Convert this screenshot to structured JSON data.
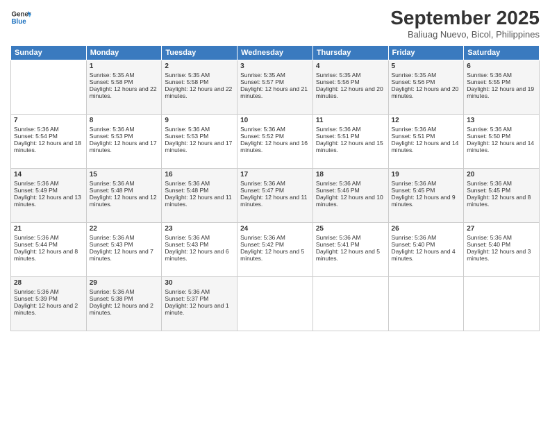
{
  "header": {
    "logo_line1": "General",
    "logo_line2": "Blue",
    "month_title": "September 2025",
    "subtitle": "Baliuag Nuevo, Bicol, Philippines"
  },
  "days_of_week": [
    "Sunday",
    "Monday",
    "Tuesday",
    "Wednesday",
    "Thursday",
    "Friday",
    "Saturday"
  ],
  "weeks": [
    [
      {
        "day": "",
        "empty": true
      },
      {
        "day": "1",
        "sunrise": "Sunrise: 5:35 AM",
        "sunset": "Sunset: 5:58 PM",
        "daylight": "Daylight: 12 hours and 22 minutes."
      },
      {
        "day": "2",
        "sunrise": "Sunrise: 5:35 AM",
        "sunset": "Sunset: 5:58 PM",
        "daylight": "Daylight: 12 hours and 22 minutes."
      },
      {
        "day": "3",
        "sunrise": "Sunrise: 5:35 AM",
        "sunset": "Sunset: 5:57 PM",
        "daylight": "Daylight: 12 hours and 21 minutes."
      },
      {
        "day": "4",
        "sunrise": "Sunrise: 5:35 AM",
        "sunset": "Sunset: 5:56 PM",
        "daylight": "Daylight: 12 hours and 20 minutes."
      },
      {
        "day": "5",
        "sunrise": "Sunrise: 5:35 AM",
        "sunset": "Sunset: 5:56 PM",
        "daylight": "Daylight: 12 hours and 20 minutes."
      },
      {
        "day": "6",
        "sunrise": "Sunrise: 5:36 AM",
        "sunset": "Sunset: 5:55 PM",
        "daylight": "Daylight: 12 hours and 19 minutes."
      }
    ],
    [
      {
        "day": "7",
        "sunrise": "Sunrise: 5:36 AM",
        "sunset": "Sunset: 5:54 PM",
        "daylight": "Daylight: 12 hours and 18 minutes."
      },
      {
        "day": "8",
        "sunrise": "Sunrise: 5:36 AM",
        "sunset": "Sunset: 5:53 PM",
        "daylight": "Daylight: 12 hours and 17 minutes."
      },
      {
        "day": "9",
        "sunrise": "Sunrise: 5:36 AM",
        "sunset": "Sunset: 5:53 PM",
        "daylight": "Daylight: 12 hours and 17 minutes."
      },
      {
        "day": "10",
        "sunrise": "Sunrise: 5:36 AM",
        "sunset": "Sunset: 5:52 PM",
        "daylight": "Daylight: 12 hours and 16 minutes."
      },
      {
        "day": "11",
        "sunrise": "Sunrise: 5:36 AM",
        "sunset": "Sunset: 5:51 PM",
        "daylight": "Daylight: 12 hours and 15 minutes."
      },
      {
        "day": "12",
        "sunrise": "Sunrise: 5:36 AM",
        "sunset": "Sunset: 5:51 PM",
        "daylight": "Daylight: 12 hours and 14 minutes."
      },
      {
        "day": "13",
        "sunrise": "Sunrise: 5:36 AM",
        "sunset": "Sunset: 5:50 PM",
        "daylight": "Daylight: 12 hours and 14 minutes."
      }
    ],
    [
      {
        "day": "14",
        "sunrise": "Sunrise: 5:36 AM",
        "sunset": "Sunset: 5:49 PM",
        "daylight": "Daylight: 12 hours and 13 minutes."
      },
      {
        "day": "15",
        "sunrise": "Sunrise: 5:36 AM",
        "sunset": "Sunset: 5:48 PM",
        "daylight": "Daylight: 12 hours and 12 minutes."
      },
      {
        "day": "16",
        "sunrise": "Sunrise: 5:36 AM",
        "sunset": "Sunset: 5:48 PM",
        "daylight": "Daylight: 12 hours and 11 minutes."
      },
      {
        "day": "17",
        "sunrise": "Sunrise: 5:36 AM",
        "sunset": "Sunset: 5:47 PM",
        "daylight": "Daylight: 12 hours and 11 minutes."
      },
      {
        "day": "18",
        "sunrise": "Sunrise: 5:36 AM",
        "sunset": "Sunset: 5:46 PM",
        "daylight": "Daylight: 12 hours and 10 minutes."
      },
      {
        "day": "19",
        "sunrise": "Sunrise: 5:36 AM",
        "sunset": "Sunset: 5:45 PM",
        "daylight": "Daylight: 12 hours and 9 minutes."
      },
      {
        "day": "20",
        "sunrise": "Sunrise: 5:36 AM",
        "sunset": "Sunset: 5:45 PM",
        "daylight": "Daylight: 12 hours and 8 minutes."
      }
    ],
    [
      {
        "day": "21",
        "sunrise": "Sunrise: 5:36 AM",
        "sunset": "Sunset: 5:44 PM",
        "daylight": "Daylight: 12 hours and 8 minutes."
      },
      {
        "day": "22",
        "sunrise": "Sunrise: 5:36 AM",
        "sunset": "Sunset: 5:43 PM",
        "daylight": "Daylight: 12 hours and 7 minutes."
      },
      {
        "day": "23",
        "sunrise": "Sunrise: 5:36 AM",
        "sunset": "Sunset: 5:43 PM",
        "daylight": "Daylight: 12 hours and 6 minutes."
      },
      {
        "day": "24",
        "sunrise": "Sunrise: 5:36 AM",
        "sunset": "Sunset: 5:42 PM",
        "daylight": "Daylight: 12 hours and 5 minutes."
      },
      {
        "day": "25",
        "sunrise": "Sunrise: 5:36 AM",
        "sunset": "Sunset: 5:41 PM",
        "daylight": "Daylight: 12 hours and 5 minutes."
      },
      {
        "day": "26",
        "sunrise": "Sunrise: 5:36 AM",
        "sunset": "Sunset: 5:40 PM",
        "daylight": "Daylight: 12 hours and 4 minutes."
      },
      {
        "day": "27",
        "sunrise": "Sunrise: 5:36 AM",
        "sunset": "Sunset: 5:40 PM",
        "daylight": "Daylight: 12 hours and 3 minutes."
      }
    ],
    [
      {
        "day": "28",
        "sunrise": "Sunrise: 5:36 AM",
        "sunset": "Sunset: 5:39 PM",
        "daylight": "Daylight: 12 hours and 2 minutes."
      },
      {
        "day": "29",
        "sunrise": "Sunrise: 5:36 AM",
        "sunset": "Sunset: 5:38 PM",
        "daylight": "Daylight: 12 hours and 2 minutes."
      },
      {
        "day": "30",
        "sunrise": "Sunrise: 5:36 AM",
        "sunset": "Sunset: 5:37 PM",
        "daylight": "Daylight: 12 hours and 1 minute."
      },
      {
        "day": "",
        "empty": true
      },
      {
        "day": "",
        "empty": true
      },
      {
        "day": "",
        "empty": true
      },
      {
        "day": "",
        "empty": true
      }
    ]
  ]
}
